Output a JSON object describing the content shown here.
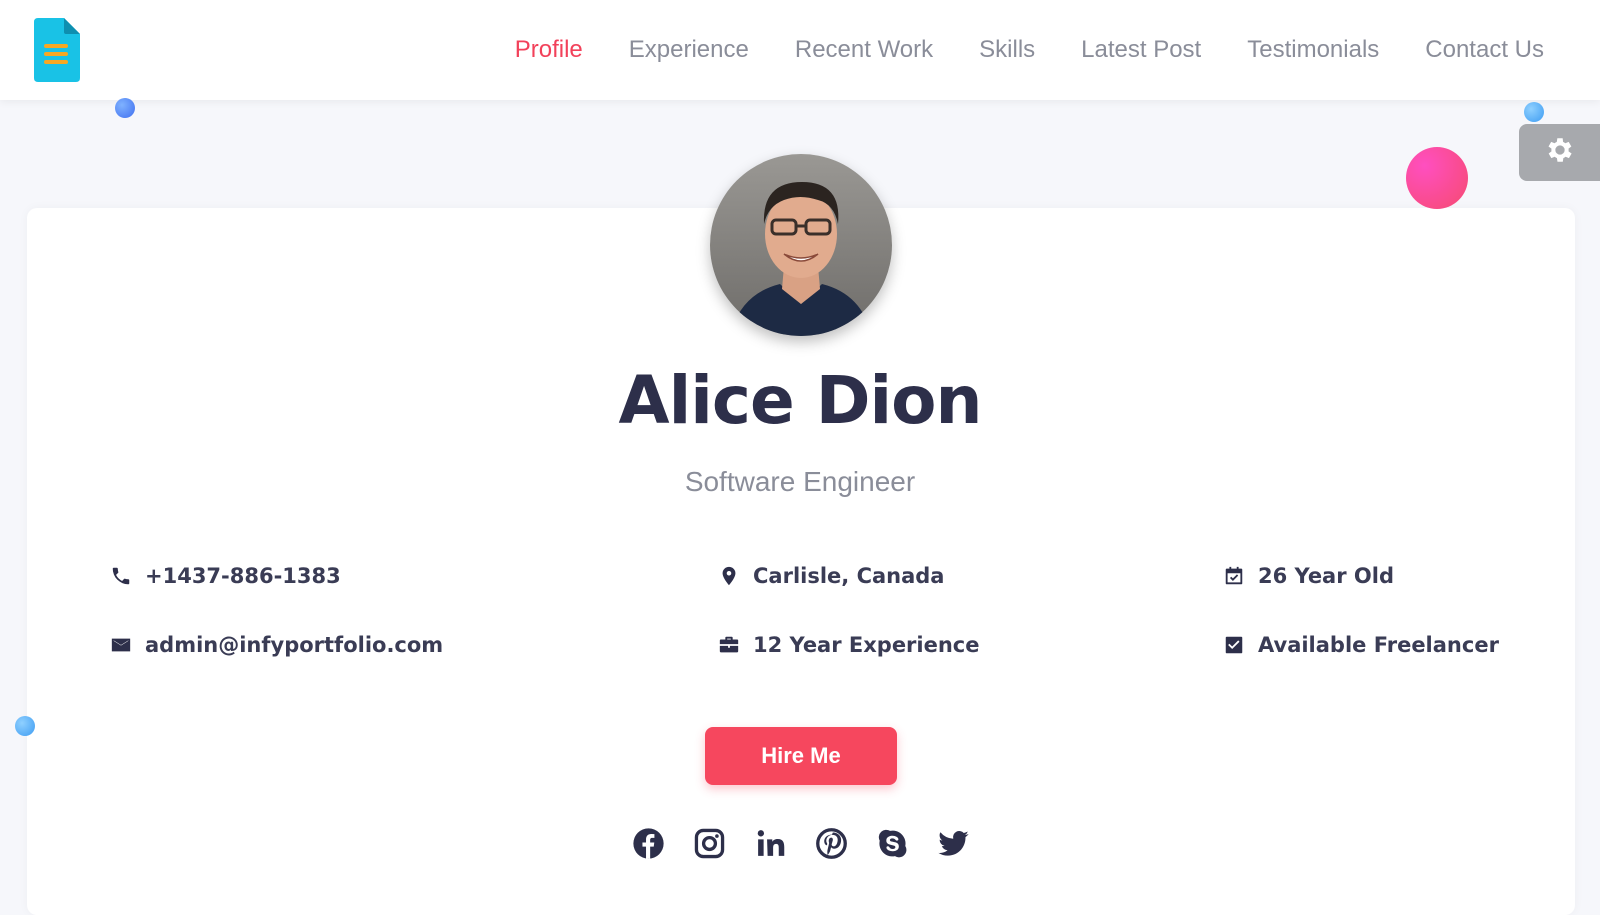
{
  "nav": {
    "items": [
      {
        "label": "Profile",
        "active": true
      },
      {
        "label": "Experience",
        "active": false
      },
      {
        "label": "Recent Work",
        "active": false
      },
      {
        "label": "Skills",
        "active": false
      },
      {
        "label": "Latest Post",
        "active": false
      },
      {
        "label": "Testimonials",
        "active": false
      },
      {
        "label": "Contact Us",
        "active": false
      }
    ]
  },
  "profile": {
    "name": "Alice Dion",
    "role": "Software Engineer",
    "phone": "+1437-886-1383",
    "email": "admin@infyportfolio.com",
    "location": "Carlisle, Canada",
    "experience": "12 Year Experience",
    "age": "26 Year Old",
    "freelance": "Available Freelancer"
  },
  "hire_button": {
    "label": "Hire Me"
  },
  "social": [
    "facebook-icon",
    "instagram-icon",
    "linkedin-icon",
    "pinterest-icon",
    "skype-icon",
    "twitter-icon"
  ],
  "colors": {
    "accent": "#f6475e",
    "nav_active": "#f2415a",
    "text_dark": "#2d2f4a",
    "text_muted": "#8a8d99",
    "settings_bg": "#a7a9ad",
    "pink_dot": "#f0407e",
    "blue_dot": "#4f8df5"
  }
}
